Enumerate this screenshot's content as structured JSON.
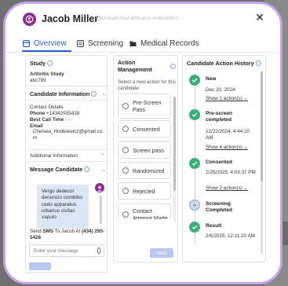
{
  "header": {
    "name": "Jacob Miller",
    "candidate_id": "0602ba40-66af-4855-a57b-94486d6ff213",
    "close_label": "✕"
  },
  "tabs": [
    {
      "label": "Overview",
      "active": true
    },
    {
      "label": "Screening",
      "active": false
    },
    {
      "label": "Medical Records",
      "active": false
    }
  ],
  "study": {
    "title": "Study",
    "name": "Arthritis Study",
    "code": "abc789"
  },
  "candidate_info": {
    "title": "Candidate Information",
    "contact_details_label": "Contact Details",
    "phone_label": "Phone",
    "phone_value": "+14342955428",
    "best_call_time_label": "Best Call Time",
    "best_call_time_value": "- -",
    "email_label": "Email",
    "email_value": "Chelsea_Hodkiewicz@gmail.co.m"
  },
  "additional_info": {
    "title": "Additional Information"
  },
  "message_candidate": {
    "title": "Message Candidate",
    "bubble_text": "Vergo dedecor denuncio combibo cedo apparatus urbanus civitas vapulo",
    "send_prefix": "Send",
    "send_sms": "SMS",
    "send_mid": "To Jacob At",
    "send_phone": "(434) 295-5428",
    "input_placeholder": "Enter your message"
  },
  "action_management": {
    "title": "Action Management",
    "hint": "Select a new action for this candidate:",
    "actions": [
      "Pre-Screen Pass",
      "Consented",
      "Screen pass",
      "Randomized",
      "Rejected",
      "Contact Attempt Made"
    ],
    "next_label": "Next"
  },
  "history": {
    "title": "Candidate Action History",
    "items": [
      {
        "status": "New",
        "date": "Dec 20, 2024",
        "link": "Show 1 action(s)",
        "state": "done"
      },
      {
        "status": "Pre-screen completed",
        "date": "12/22/2024, 4:44:10 AM",
        "link": "Show 4 action(s)",
        "state": "done"
      },
      {
        "status": "Consented",
        "date": "1/25/2025, 4:03:37 PM",
        "link": "Show 2 action(s)",
        "state": "done"
      },
      {
        "status": "Screening Completed",
        "date": "",
        "link": "",
        "state": "pending"
      },
      {
        "status": "Result",
        "date": "2/6/2025, 12:11:20 AM",
        "link": "",
        "state": "done"
      }
    ]
  },
  "colors": {
    "accent": "#2a5fd6",
    "frame_border": "#c9a2ec",
    "avatar": "#8e2b8e",
    "success": "#3cae7a"
  }
}
